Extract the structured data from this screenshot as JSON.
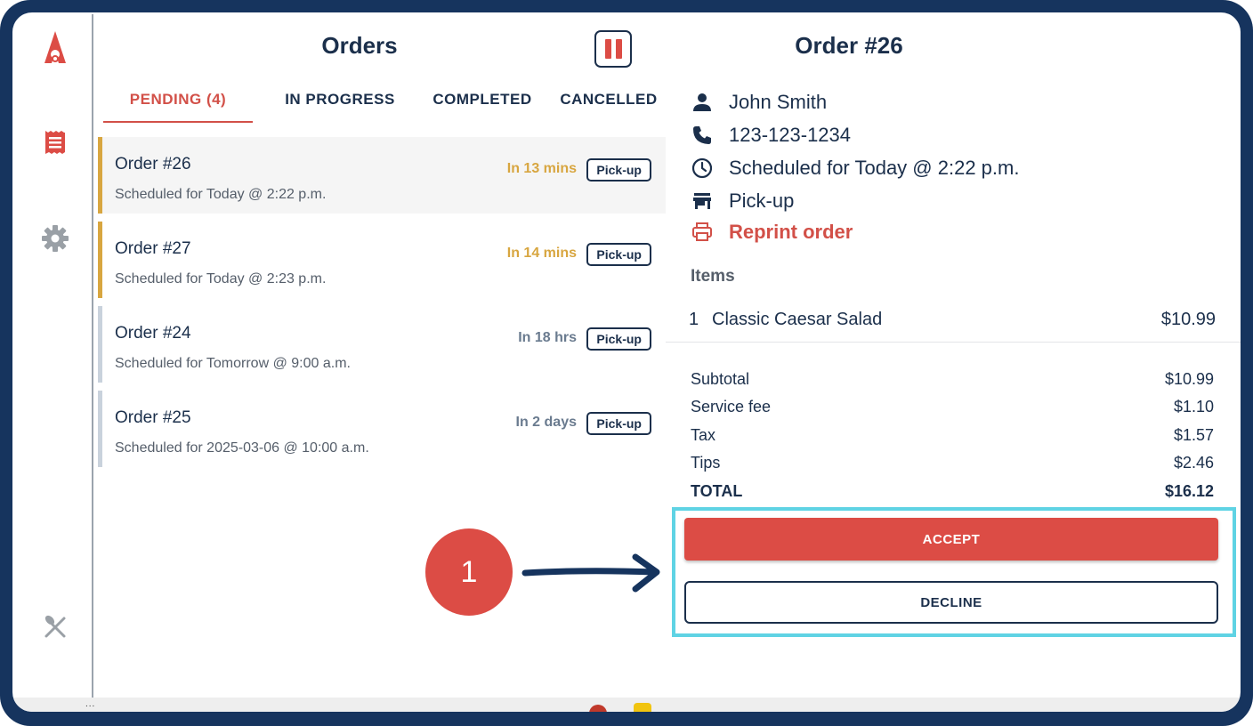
{
  "colors": {
    "frame": "#16345e",
    "brand_red": "#dc4c45",
    "navy": "#1b2f4b",
    "eta_soon": "#d8a640",
    "eta_later": "#6a7b8f",
    "highlight": "#5fd3e4"
  },
  "sidebar": {
    "icons": [
      "rocket-logo-icon",
      "orders-receipt-icon",
      "gear-icon",
      "utensils-icon"
    ]
  },
  "orders_panel": {
    "title": "Orders",
    "pause_icon": "pause-icon",
    "tabs": [
      {
        "label": "PENDING (4)",
        "active": true
      },
      {
        "label": "IN PROGRESS",
        "active": false
      },
      {
        "label": "COMPLETED",
        "active": false
      },
      {
        "label": "CANCELLED",
        "active": false
      }
    ],
    "orders": [
      {
        "name": "Order #26",
        "schedule": "Scheduled for Today @ 2:22 p.m.",
        "eta": "In 13 mins",
        "type": "Pick-up"
      },
      {
        "name": "Order #27",
        "schedule": "Scheduled for Today @ 2:23 p.m.",
        "eta": "In 14 mins",
        "type": "Pick-up"
      },
      {
        "name": "Order #24",
        "schedule": "Scheduled for Tomorrow @ 9:00 a.m.",
        "eta": "In 18 hrs",
        "type": "Pick-up"
      },
      {
        "name": "Order #25",
        "schedule": "Scheduled for 2025-03-06 @ 10:00 a.m.",
        "eta": "In 2 days",
        "type": "Pick-up"
      }
    ]
  },
  "callout": {
    "number": "1"
  },
  "detail": {
    "title": "Order #26",
    "customer_name": "John Smith",
    "phone": "123-123-1234",
    "schedule": "Scheduled for Today @ 2:22 p.m.",
    "fulfillment": "Pick-up",
    "reprint_label": "Reprint order",
    "items_label": "Items",
    "items": [
      {
        "qty": "1",
        "name": "Classic Caesar Salad",
        "price": "$10.99"
      }
    ],
    "totals": {
      "subtotal_label": "Subtotal",
      "subtotal": "$10.99",
      "service_fee_label": "Service fee",
      "service_fee": "$1.10",
      "tax_label": "Tax",
      "tax": "$1.57",
      "tips_label": "Tips",
      "tips": "$2.46",
      "total_label": "TOTAL",
      "total": "$16.12"
    },
    "accept_label": "ACCEPT",
    "decline_label": "DECLINE"
  },
  "bottom_bar": {
    "handle": "..."
  }
}
